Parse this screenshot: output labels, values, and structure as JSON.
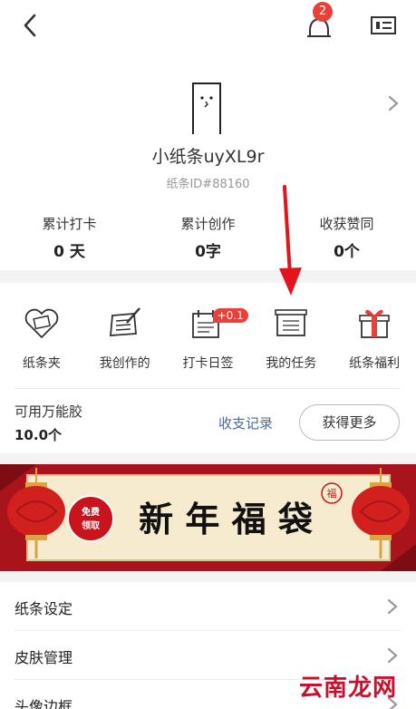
{
  "topbar": {
    "notification_count": "2"
  },
  "profile": {
    "nickname": "小纸条uyXL9r",
    "user_id": "纸条ID#88160"
  },
  "stats": [
    {
      "label": "累计打卡",
      "value": "0 天"
    },
    {
      "label": "累计创作",
      "value": "0字"
    },
    {
      "label": "收获赞同",
      "value": "0个"
    }
  ],
  "grid": [
    {
      "label": "纸条夹",
      "icon": "heart-folder-icon"
    },
    {
      "label": "我创作的",
      "icon": "pen-note-icon"
    },
    {
      "label": "打卡日签",
      "icon": "calendar-check-icon",
      "badge": "+0.1"
    },
    {
      "label": "我的任务",
      "icon": "task-scroll-icon"
    },
    {
      "label": "纸条福利",
      "icon": "gift-box-icon"
    }
  ],
  "wallet": {
    "label": "可用万能胶",
    "value": "10.0个",
    "records_link": "收支记录",
    "more_button": "获得更多"
  },
  "banner": {
    "badge_line1": "免费",
    "badge_line2": "领取",
    "title": "新 年 福 袋",
    "seal": "福"
  },
  "menu": [
    {
      "label": "纸条设定"
    },
    {
      "label": "皮肤管理"
    },
    {
      "label": "头像边框"
    }
  ],
  "watermark": "云南龙网",
  "colors": {
    "accent_red": "#e8403a",
    "link_blue": "#4a6a9a",
    "banner_red": "#a9141c"
  }
}
